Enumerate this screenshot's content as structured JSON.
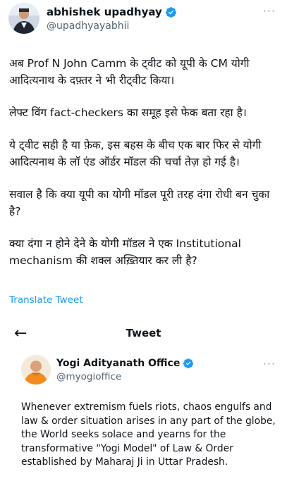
{
  "tweet": {
    "author_name": "abhishek upadhyay",
    "author_handle": "@upadhyayabhii",
    "more_glyph": "···",
    "paragraphs": [
      "अब Prof N John Camm के ट्वीट को यूपी के CM योगी आदित्यनाथ के दफ़्तर ने भी रीट्वीट किया।",
      "लेफ्ट विंग fact-checkers का समूह इसे फेक बता रहा है।",
      "ये ट्वीट सही है या फ़ेक, इस बहस के बीच एक बार फिर से योगी आदित्यनाथ के लॉ एंड ऑर्डर मॉडल की चर्चा तेज़ हो गई है।",
      "सवाल है कि क्या यूपी का योगी मॉडल पूरी तरह दंगा रोधी बन चुका है?",
      "क्या दंगा न होने देने के योगी मॉडल ने एक Institutional mechanism की शक्ल अख़्तियार कर ली है?"
    ],
    "translate_label": "Translate Tweet"
  },
  "embedded": {
    "header_title": "Tweet",
    "back_glyph": "←",
    "author_name": "Yogi Adityanath Office",
    "author_handle": "@myogioffice",
    "more_glyph": "···",
    "text": "Whenever extremism fuels riots, chaos engulfs and law & order situation arises in any part of the globe, the World seeks solace and yearns for the transformative \"Yogi Model\" of Law & Order established by Maharaj Ji in Uttar Pradesh."
  },
  "colors": {
    "accent": "#1d9bf0",
    "text": "#0f1419",
    "muted": "#536471"
  }
}
